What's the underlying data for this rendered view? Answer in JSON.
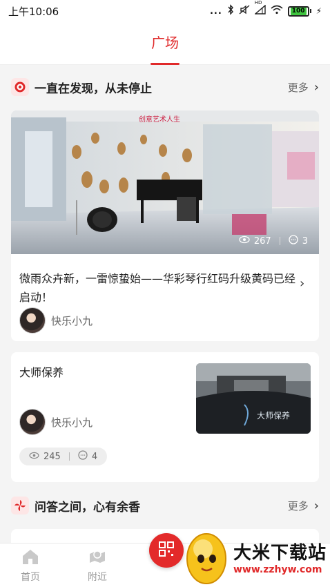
{
  "status_bar": {
    "time": "上午10:06",
    "signal_text": "...",
    "hd_label": "HD",
    "battery": "100"
  },
  "header": {
    "active_tab": "广场"
  },
  "section1": {
    "title": "一直在发现，从未停止",
    "more": "更多"
  },
  "post1": {
    "views": "267",
    "comments": "3",
    "title": "微雨众卉新，一雷惊蛰始——华彩琴行红码升级黄码已经启动！",
    "author": "快乐小九",
    "photo_sign": "创意艺术人生"
  },
  "post2": {
    "title": "大师保养",
    "author": "快乐小九",
    "views": "245",
    "comments": "4",
    "photo_text": "大师保养"
  },
  "section2": {
    "title": "问答之间，心有余香",
    "more": "更多"
  },
  "bottom_nav": {
    "home": "首页",
    "nearby": "附近"
  },
  "watermark": {
    "name": "大米下载站",
    "url": "www.zzhyw.com"
  },
  "colors": {
    "accent": "#e0292a",
    "background": "#f4f4f4"
  }
}
